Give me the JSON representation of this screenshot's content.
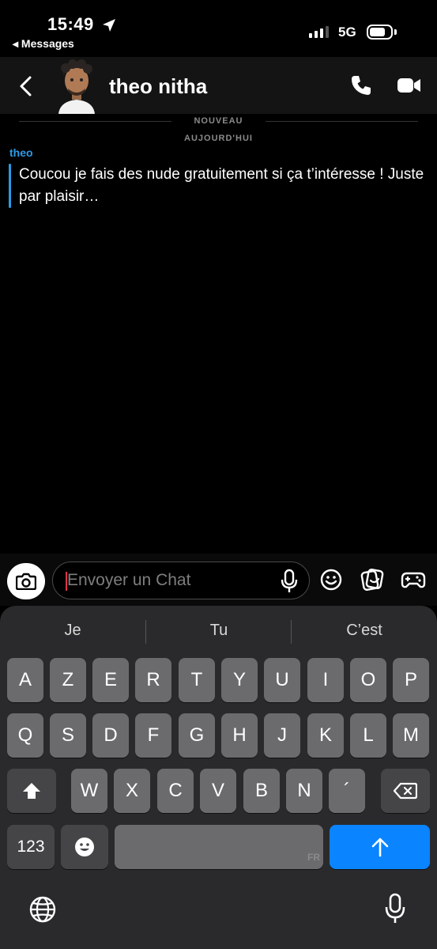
{
  "status_bar": {
    "time": "15:49",
    "back_app": "◂ Messages",
    "network": "5G"
  },
  "header": {
    "contact_name": "theo nitha"
  },
  "conversation": {
    "label_new": "NOUVEAU",
    "label_today": "AUJOURD'HUI",
    "sender": "theo",
    "message": "Coucou je fais des nude gratuitement si ça t’intéresse ! Juste par plaisir…"
  },
  "composer": {
    "placeholder": "Envoyer un Chat"
  },
  "keyboard": {
    "suggestions": [
      "Je",
      "Tu",
      "C’est"
    ],
    "row1": [
      "A",
      "Z",
      "E",
      "R",
      "T",
      "Y",
      "U",
      "I",
      "O",
      "P"
    ],
    "row2": [
      "Q",
      "S",
      "D",
      "F",
      "G",
      "H",
      "J",
      "K",
      "L",
      "M"
    ],
    "row3": [
      "W",
      "X",
      "C",
      "V",
      "B",
      "N",
      "´"
    ],
    "numbers_key": "123",
    "language_tag": "FR"
  },
  "colors": {
    "accent_blue": "#2e9ae6",
    "send_key": "#0a84ff",
    "cursor": "#e0324a"
  }
}
